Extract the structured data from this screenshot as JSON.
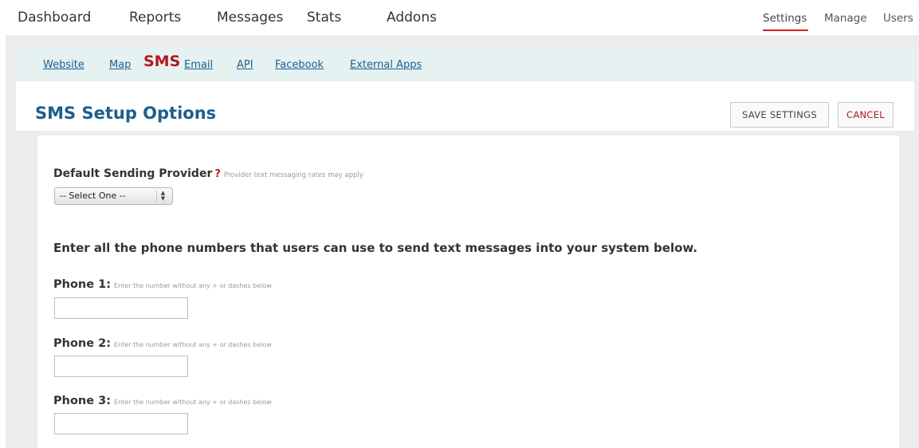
{
  "topnav": {
    "main_items": [
      {
        "label": "Dashboard"
      },
      {
        "label": "Reports"
      },
      {
        "label": "Messages"
      },
      {
        "label": "Stats"
      },
      {
        "label": "Addons"
      }
    ],
    "right_items": [
      {
        "label": "Settings",
        "active": true
      },
      {
        "label": "Manage"
      },
      {
        "label": "Users"
      }
    ],
    "active_underline_color": "#d02020"
  },
  "subtabs": [
    {
      "label": "Website"
    },
    {
      "label": "Map"
    },
    {
      "label": "SMS",
      "active": true
    },
    {
      "label": "Email"
    },
    {
      "label": "API"
    },
    {
      "label": "Facebook"
    },
    {
      "label": "External Apps"
    }
  ],
  "header": {
    "title": "SMS Setup Options",
    "save_label": "SAVE SETTINGS",
    "cancel_label": "CANCEL"
  },
  "provider": {
    "label": "Default Sending Provider",
    "help_mark": "?",
    "hint": "Provider text messaging rates may apply",
    "selected": "-- Select One --"
  },
  "instructions": "Enter all the phone numbers that users can use to send text messages into your system below.",
  "phones": [
    {
      "label": "Phone 1:",
      "hint": "Enter the number without any + or dashes below",
      "value": ""
    },
    {
      "label": "Phone 2:",
      "hint": "Enter the number without any + or dashes below",
      "value": ""
    },
    {
      "label": "Phone 3:",
      "hint": "Enter the number without any + or dashes below",
      "value": ""
    }
  ],
  "colors": {
    "link": "#1c5f8d",
    "active_tab": "#b01a1a",
    "subtab_bar": "#e6f1f2",
    "page_bg": "#ececec"
  }
}
